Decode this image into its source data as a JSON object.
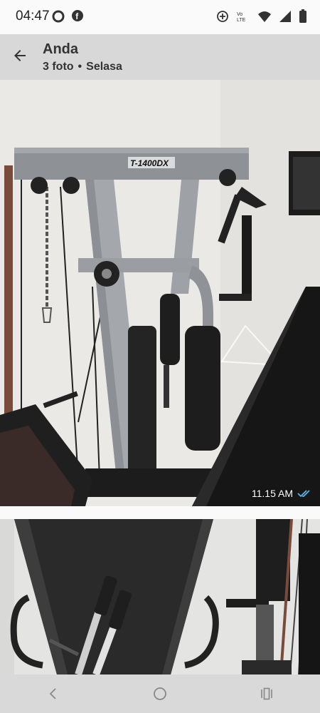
{
  "status_bar": {
    "time": "04:47",
    "left_icons": [
      "record-icon",
      "facebook-icon"
    ],
    "right_icons": [
      "data-saver-icon",
      "volte-icon",
      "wifi-icon",
      "signal-icon",
      "battery-icon"
    ],
    "volte_label": "Vo LTE"
  },
  "header": {
    "title": "Anda",
    "photo_count": "3 foto",
    "separator": "•",
    "day": "Selasa"
  },
  "photos": [
    {
      "description": "home-gym-photo",
      "machine_label": "T-1400DX",
      "timestamp": "11.15 AM",
      "read_status": "double-check-icon",
      "read_color": "#4fb6ec"
    },
    {
      "description": "bench-photo"
    }
  ],
  "nav": {
    "buttons": [
      "back-nav-icon",
      "home-nav-icon",
      "recents-nav-icon"
    ]
  },
  "colors": {
    "app_bar": "#d8d8d8",
    "nav_bar": "#d9d9d9"
  }
}
